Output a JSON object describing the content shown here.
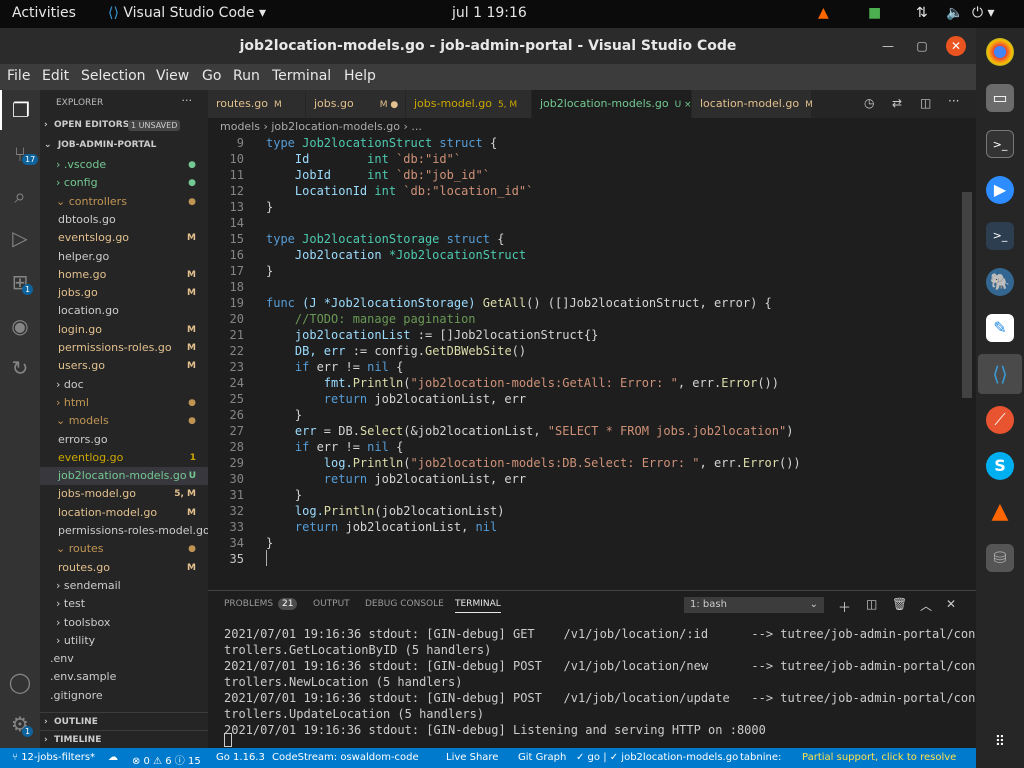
{
  "topbar": {
    "activities": "Activities",
    "app": "Visual Studio Code",
    "clock": "jul 1  19:16"
  },
  "window": {
    "title": "job2location-models.go - job-admin-portal - Visual Studio Code"
  },
  "menu": [
    "File",
    "Edit",
    "Selection",
    "View",
    "Go",
    "Run",
    "Terminal",
    "Help"
  ],
  "sidebar": {
    "header": "EXPLORER",
    "open_editors": "OPEN EDITORS",
    "unsaved": "1 UNSAVED",
    "project": "JOB-ADMIN-PORTAL",
    "outline": "OUTLINE",
    "timeline": "TIMELINE",
    "items": [
      {
        "label": ".vscode",
        "mark": "●",
        "color": "#73c991"
      },
      {
        "label": "config",
        "mark": "●",
        "color": "#73c991"
      },
      {
        "label": "controllers",
        "mark": "●",
        "color": "#c09553"
      },
      {
        "label": "dbtools.go",
        "mark": "",
        "color": "#ccc"
      },
      {
        "label": "eventslog.go",
        "mark": "M",
        "color": "#e2c08d"
      },
      {
        "label": "helper.go",
        "mark": "",
        "color": "#ccc"
      },
      {
        "label": "home.go",
        "mark": "M",
        "color": "#e2c08d"
      },
      {
        "label": "jobs.go",
        "mark": "M",
        "color": "#e2c08d"
      },
      {
        "label": "location.go",
        "mark": "",
        "color": "#ccc"
      },
      {
        "label": "login.go",
        "mark": "M",
        "color": "#e2c08d"
      },
      {
        "label": "permissions-roles.go",
        "mark": "M",
        "color": "#e2c08d"
      },
      {
        "label": "users.go",
        "mark": "M",
        "color": "#e2c08d"
      },
      {
        "label": "doc",
        "mark": "",
        "color": "#ccc"
      },
      {
        "label": "html",
        "mark": "●",
        "color": "#c09553"
      },
      {
        "label": "models",
        "mark": "●",
        "color": "#c09553"
      },
      {
        "label": "errors.go",
        "mark": "",
        "color": "#ccc"
      },
      {
        "label": "eventlog.go",
        "mark": "1",
        "color": "#cca700"
      },
      {
        "label": "job2location-models.go",
        "mark": "U",
        "color": "#73c991"
      },
      {
        "label": "jobs-model.go",
        "mark": "5, M",
        "color": "#e2c08d"
      },
      {
        "label": "location-model.go",
        "mark": "M",
        "color": "#e2c08d"
      },
      {
        "label": "permissions-roles-model.go",
        "mark": "",
        "color": "#ccc"
      },
      {
        "label": "routes",
        "mark": "●",
        "color": "#c09553"
      },
      {
        "label": "routes.go",
        "mark": "M",
        "color": "#e2c08d"
      },
      {
        "label": "sendemail",
        "mark": "",
        "color": "#ccc"
      },
      {
        "label": "test",
        "mark": "",
        "color": "#ccc"
      },
      {
        "label": "toolsbox",
        "mark": "",
        "color": "#ccc"
      },
      {
        "label": "utility",
        "mark": "",
        "color": "#ccc"
      },
      {
        "label": ".env",
        "mark": "",
        "color": "#ccc"
      },
      {
        "label": ".env.sample",
        "mark": "",
        "color": "#ccc"
      },
      {
        "label": ".gitignore",
        "mark": "",
        "color": "#ccc"
      }
    ]
  },
  "tabs": [
    {
      "label": "routes.go",
      "mark": "M"
    },
    {
      "label": "jobs.go",
      "mark": "M ●"
    },
    {
      "label": "jobs-model.go",
      "mark": "5, M"
    },
    {
      "label": "job2location-models.go",
      "mark": "U  ×"
    },
    {
      "label": "location-model.go",
      "mark": "M"
    }
  ],
  "breadcrumb": "models  ›  job2location-models.go  ›  ...",
  "line_numbers": [
    "9",
    "10",
    "11",
    "12",
    "13",
    "14",
    "15",
    "16",
    "17",
    "18",
    "19",
    "20",
    "21",
    "22",
    "23",
    "24",
    "25",
    "26",
    "27",
    "28",
    "29",
    "30",
    "31",
    "32",
    "33",
    "34",
    "35"
  ],
  "code": {
    "l9a": "type ",
    "l9b": "Job2locationStruct",
    "l9c": " struct",
    "l9d": " {",
    "l10a": "    Id",
    "l10b": "        int",
    "l10c": " `db:",
    "l10d": "\"id\"",
    "l10e": "`",
    "l11a": "    JobId",
    "l11b": "     int",
    "l11c": " `db:",
    "l11d": "\"job_id\"",
    "l11e": "`",
    "l12a": "    LocationId",
    "l12b": " int",
    "l12c": " `db:",
    "l12d": "\"location_id\"",
    "l12e": "`",
    "l13": "}",
    "l15a": "type ",
    "l15b": "Job2locationStorage",
    "l15c": " struct",
    "l15d": " {",
    "l16a": "    Job2location ",
    "l16b": "*Job2locationStruct",
    "l17": "}",
    "l19a": "func ",
    "l19b": "(J *Job2locationStorage) ",
    "l19c": "GetAll",
    "l19d": "() ([]Job2locationStruct, error) {",
    "l20": "    //TODO: manage pagination",
    "l21a": "    job2locationList",
    "l21b": " := []Job2locationStruct{}",
    "l22a": "    DB, err",
    "l22b": " := config.",
    "l22c": "GetDBWebSite",
    "l22d": "()",
    "l23a": "    if",
    "l23b": " err != ",
    "l23c": "nil",
    "l23d": " {",
    "l24a": "        fmt.",
    "l24b": "Println",
    "l24c": "(",
    "l24d": "\"job2location-models:GetAll: Error: \"",
    "l24e": ", err.",
    "l24f": "Error",
    "l24g": "())",
    "l25a": "        return",
    "l25b": " job2locationList, err",
    "l26": "    }",
    "l27a": "    err",
    "l27b": " = DB.",
    "l27c": "Select",
    "l27d": "(&job2locationList, ",
    "l27e": "\"SELECT * FROM jobs.job2location\"",
    "l27f": ")",
    "l28a": "    if",
    "l28b": " err != ",
    "l28c": "nil",
    "l28d": " {",
    "l29a": "        log.",
    "l29b": "Println",
    "l29c": "(",
    "l29d": "\"job2location-models:DB.Select: Error: \"",
    "l29e": ", err.",
    "l29f": "Error",
    "l29g": "())",
    "l30a": "        return",
    "l30b": " job2locationList, err",
    "l31": "    }",
    "l32a": "    log.",
    "l32b": "Println",
    "l32c": "(job2locationList)",
    "l33a": "    return",
    "l33b": " job2locationList, ",
    "l33c": "nil",
    "l34": "}"
  },
  "panel": {
    "problems": "PROBLEMS",
    "problems_count": "21",
    "output": "OUTPUT",
    "debug": "DEBUG CONSOLE",
    "terminal": "TERMINAL",
    "shell": "1: bash"
  },
  "terminal_lines": [
    "2021/07/01 19:16:36 stdout: [GIN-debug] GET    /v1/job/location/:id      --> tutree/job-admin-portal/con",
    "trollers.GetLocationByID (5 handlers)",
    "2021/07/01 19:16:36 stdout: [GIN-debug] POST   /v1/job/location/new      --> tutree/job-admin-portal/con",
    "trollers.NewLocation (5 handlers)",
    "2021/07/01 19:16:36 stdout: [GIN-debug] POST   /v1/job/location/update   --> tutree/job-admin-portal/con",
    "trollers.UpdateLocation (5 handlers)",
    "2021/07/01 19:16:36 stdout: [GIN-debug] Listening and serving HTTP on :8000"
  ],
  "status": {
    "branch": "12-jobs-filters*",
    "problems": "⊗ 0 ⚠ 6 ⓘ 15",
    "go": "Go 1.16.3",
    "codestream": "CodeStream: oswaldom-code",
    "liveshare": "Live Share",
    "gitgraph": "Git Graph",
    "go_check": "✓ go | ✓ job2location-models.go",
    "tabnine": "tabnine:",
    "partial": "Partial support, click to resolve"
  },
  "badges": {
    "scm": "17",
    "ext": "1",
    "settings": "1"
  }
}
